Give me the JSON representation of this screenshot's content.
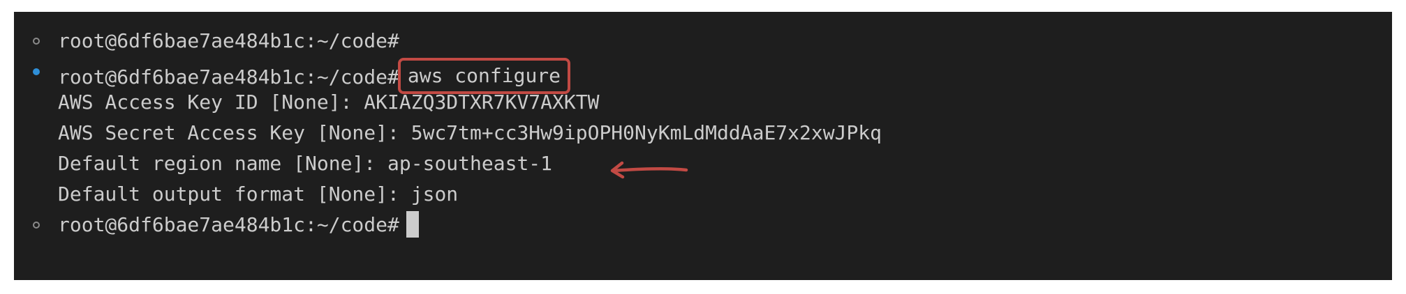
{
  "terminal": {
    "prompt": "root@6df6bae7ae484b1c:~/code#",
    "lines": [
      {
        "type": "prompt",
        "command": ""
      },
      {
        "type": "prompt",
        "command": "aws configure"
      },
      {
        "type": "output",
        "text": "AWS Access Key ID [None]: AKIAZQ3DTXR7KV7AXKTW"
      },
      {
        "type": "output",
        "text": "AWS Secret Access Key [None]: 5wc7tm+cc3Hw9ipOPH0NyKmLdMddAaE7x2xwJPkq"
      },
      {
        "type": "output",
        "text": "Default region name [None]: ap-southeast-1"
      },
      {
        "type": "output",
        "text": "Default output format [None]: json"
      },
      {
        "type": "prompt",
        "command": ""
      }
    ]
  },
  "colors": {
    "background": "#1e1e1e",
    "text": "#cccccc",
    "highlight": "#c24a44",
    "active_dot": "#2f8fd8",
    "inactive_dot": "#8b8b8b"
  },
  "icons": {
    "status_inactive": "circle-outline-icon",
    "status_active": "circle-filled-icon",
    "annotation": "red-arrow-icon"
  }
}
